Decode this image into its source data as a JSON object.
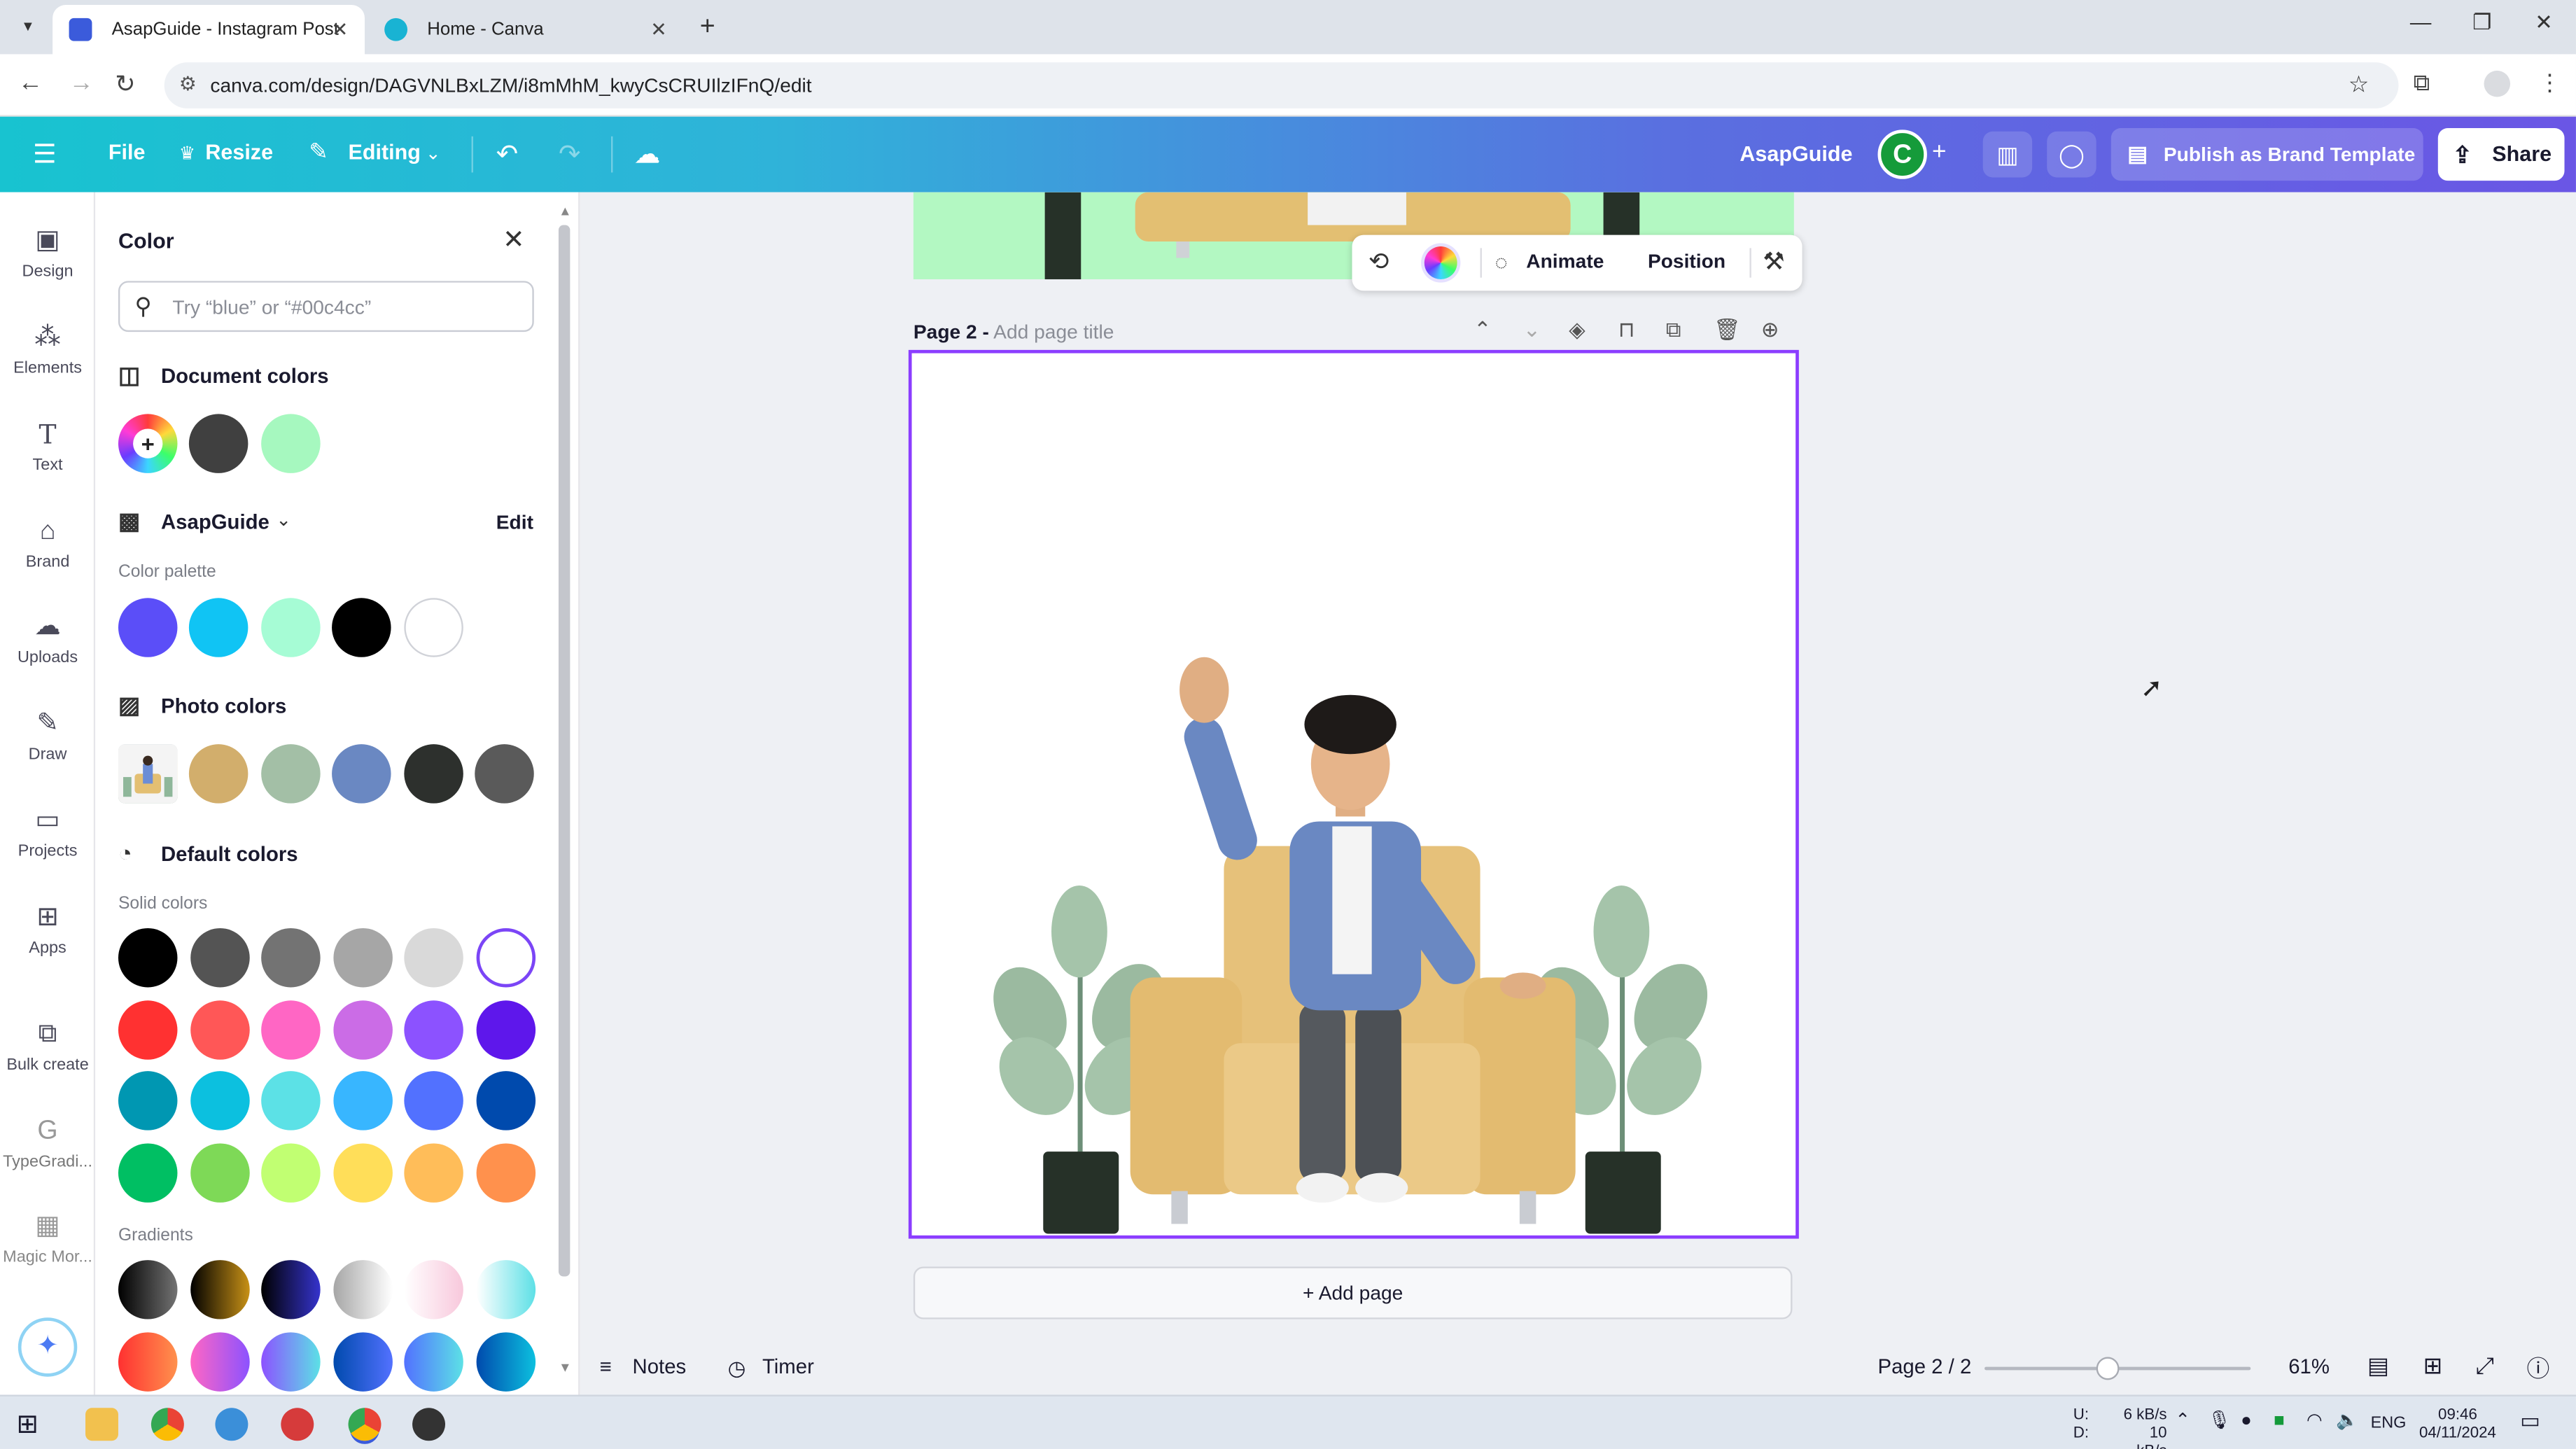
{
  "browser": {
    "tabs": [
      {
        "label": "AsapGuide - Instagram Post",
        "active": true
      },
      {
        "label": "Home - Canva",
        "active": false
      }
    ],
    "url": "canva.com/design/DAGVNLBxLZM/i8mMhM_kwyCsCRUIlzIFnQ/edit"
  },
  "header": {
    "file": "File",
    "resize": "Resize",
    "editing": "Editing",
    "brand_name": "AsapGuide",
    "avatar_letter": "C",
    "publish": "Publish as Brand Template",
    "share": "Share"
  },
  "rail": {
    "items": [
      {
        "label": "Design",
        "icon": "design-icon"
      },
      {
        "label": "Elements",
        "icon": "elements-icon"
      },
      {
        "label": "Text",
        "icon": "text-icon"
      },
      {
        "label": "Brand",
        "icon": "brand-icon"
      },
      {
        "label": "Uploads",
        "icon": "uploads-icon"
      },
      {
        "label": "Draw",
        "icon": "draw-icon"
      },
      {
        "label": "Projects",
        "icon": "projects-icon"
      },
      {
        "label": "Apps",
        "icon": "apps-icon"
      },
      {
        "label": "Bulk create",
        "icon": "bulk-create-icon"
      },
      {
        "label": "TypeGradi...",
        "icon": "typegradient-icon"
      },
      {
        "label": "Magic Mor...",
        "icon": "magic-morph-icon"
      }
    ]
  },
  "color_panel": {
    "title": "Color",
    "search_placeholder": "Try “blue” or “#00c4cc”",
    "document_colors": {
      "label": "Document colors",
      "swatches": [
        "#404040",
        "#a6f8bf"
      ]
    },
    "brand_kit": {
      "name": "AsapGuide",
      "edit": "Edit",
      "palette_label": "Color palette",
      "swatches": [
        "#5b4ef8",
        "#10c4f4",
        "#a6fcd5",
        "#000000",
        "#ffffff"
      ]
    },
    "photo_colors": {
      "label": "Photo colors",
      "swatches": [
        "#d2ae6c",
        "#a3bfa6",
        "#6a88c2",
        "#2d302d",
        "#5a5a5a"
      ]
    },
    "default_colors": {
      "label": "Default colors",
      "solid_label": "Solid colors",
      "solid": [
        [
          "#000000",
          "#545454",
          "#737373",
          "#a6a6a6",
          "#d9d9d9",
          "#ffffff"
        ],
        [
          "#ff3131",
          "#ff5757",
          "#ff66c4",
          "#cb6ce6",
          "#8c52ff",
          "#5e17eb"
        ],
        [
          "#0097b2",
          "#0cc0df",
          "#5ce1e6",
          "#38b6ff",
          "#5271ff",
          "#004aad"
        ],
        [
          "#00bf63",
          "#7ed957",
          "#c1ff72",
          "#ffde59",
          "#ffbd59",
          "#ff914d"
        ]
      ],
      "gradients_label": "Gradients",
      "gradients": [
        [
          "#000000",
          "#737373"
        ],
        [
          "#000000",
          "#c89116"
        ],
        [
          "#000000",
          "#3533cd"
        ],
        [
          "#a6a6a6",
          "#ffffff"
        ],
        [
          "#ffffff",
          "#f8c8dc"
        ],
        [
          "#ffffff",
          "#5de0e6"
        ]
      ],
      "gradients_row2": [
        [
          "#ff3131",
          "#ff914d"
        ],
        [
          "#ff66c4",
          "#8c52ff"
        ],
        [
          "#8c52ff",
          "#5ce1e6"
        ],
        [
          "#004aad",
          "#5271ff"
        ],
        [
          "#5271ff",
          "#5ce1e6"
        ],
        [
          "#004aad",
          "#0cc0df"
        ]
      ]
    }
  },
  "context_toolbar": {
    "animate": "Animate",
    "position": "Position"
  },
  "page": {
    "label": "Page 2 -",
    "title_placeholder": "Add page title",
    "add_page": "+ Add page"
  },
  "bottom": {
    "notes": "Notes",
    "timer": "Timer",
    "page_indicator": "Page 2 / 2",
    "zoom": "61%",
    "zoom_fraction": 0.61
  },
  "taskbar": {
    "net_up": "6 kB/s",
    "net_down": "10 kB/s",
    "net_up_label": "U:",
    "net_down_label": "D:",
    "lang": "ENG",
    "time": "09:46",
    "date": "04/11/2024"
  }
}
